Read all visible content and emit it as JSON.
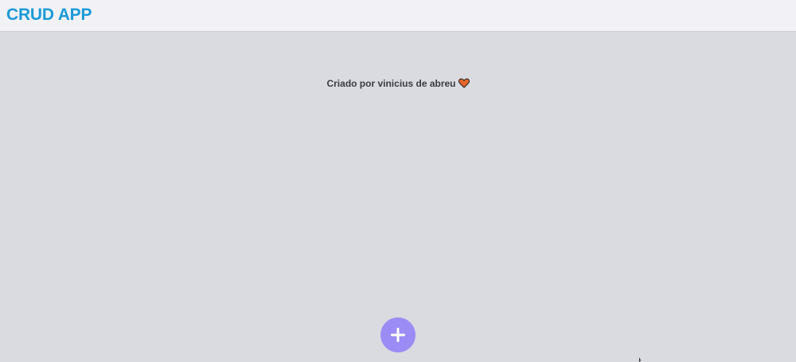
{
  "header": {
    "title": "CRUD APP"
  },
  "credit": {
    "text": "Criado por vinicius de abreu",
    "icon": "heart-icon"
  },
  "fab": {
    "icon": "plus-icon"
  },
  "colors": {
    "brand": "#1a9ad6",
    "background": "#dadae1",
    "header_bg": "#f2f2f6",
    "fab": "#9b8cf5",
    "heart": "#e8662a"
  }
}
